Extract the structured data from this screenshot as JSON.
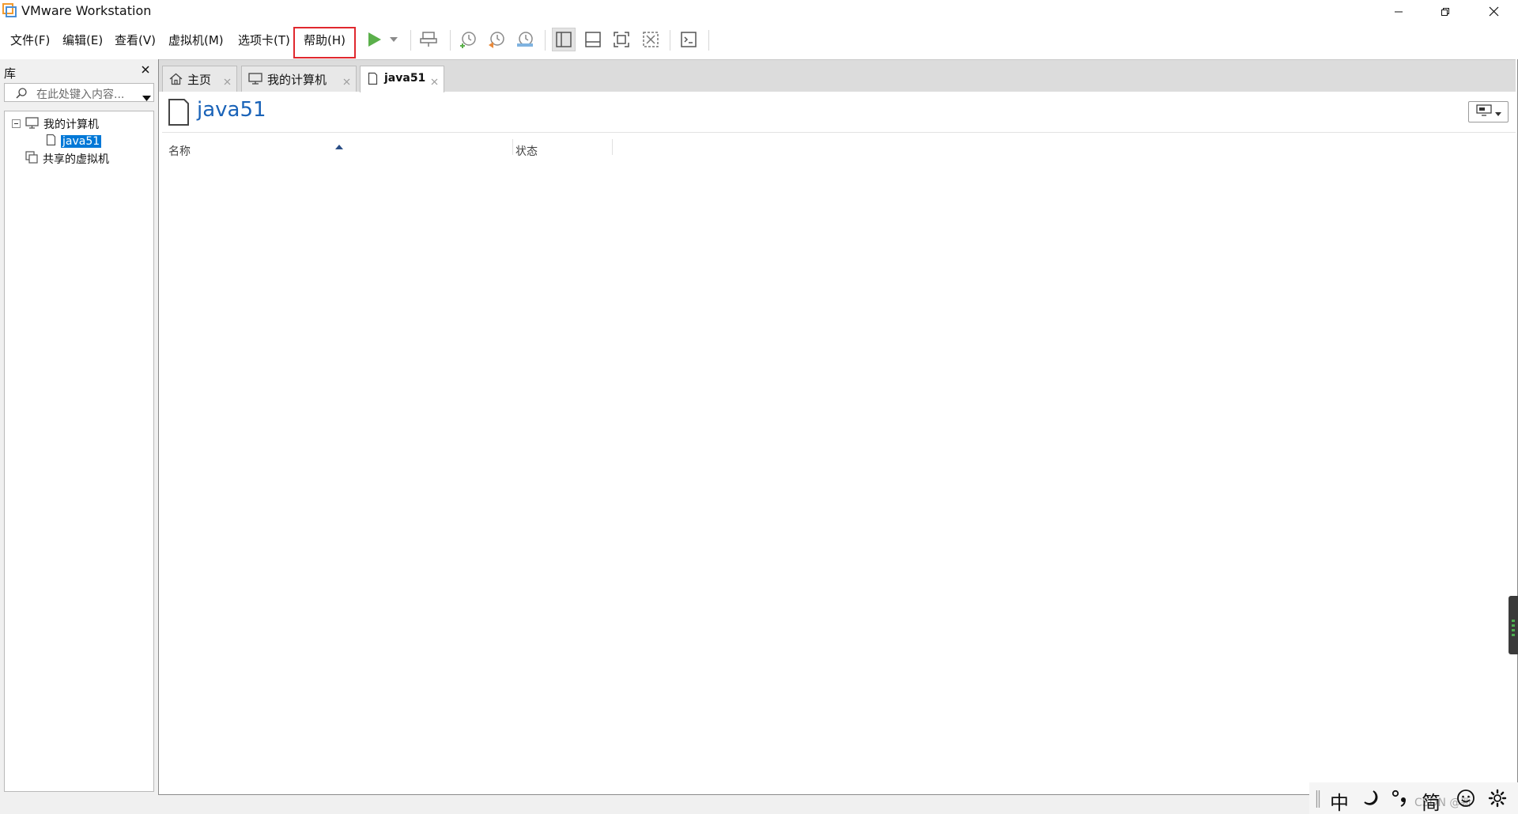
{
  "window": {
    "title": "VMware Workstation"
  },
  "menu": {
    "file": "文件(F)",
    "edit": "编辑(E)",
    "view": "查看(V)",
    "vm": "虚拟机(M)",
    "tabs": "选项卡(T)",
    "help": "帮助(H)"
  },
  "toolbar": {
    "icons": [
      "play-icon",
      "dropdown-icon",
      "send-ctrl-alt-del-icon",
      "snapshot-take-icon",
      "snapshot-revert-icon",
      "snapshot-manager-icon",
      "library-view-icon",
      "thumbnail-view-icon",
      "fullscreen-icon",
      "unity-icon",
      "console-icon"
    ]
  },
  "library": {
    "header": "库",
    "search_placeholder": "在此处键入内容...",
    "tree": {
      "my_computer": "我的计算机",
      "java51": "java51",
      "shared": "共享的虚拟机"
    }
  },
  "tabs": {
    "home": "主页",
    "my_computer": "我的计算机",
    "java51": "java51"
  },
  "main": {
    "vm_title": "java51",
    "columns": {
      "name": "名称",
      "status": "状态"
    }
  },
  "ime": {
    "lang": "中",
    "simplified": "简",
    "watermark": "CSDN @新"
  },
  "colors": {
    "accent_blue": "#1a63b8",
    "selection": "#0078d7",
    "highlight_red": "#e0282e",
    "play_green": "#5bb04b"
  }
}
